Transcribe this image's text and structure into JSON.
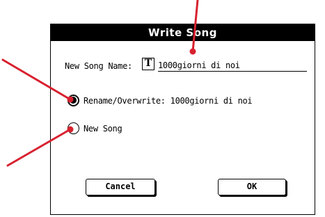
{
  "dialog": {
    "title": "Write Song",
    "name_label": "New Song Name:",
    "type_icon": "T",
    "type_icon_name": "text-edit-icon",
    "name_value": "1000giorni di noi",
    "options": [
      {
        "label": "Rename/Overwrite: 1000giorni di noi",
        "checked": true
      },
      {
        "label": "New Song",
        "checked": false
      }
    ],
    "cancel_label": "Cancel",
    "ok_label": "OK"
  },
  "colors": {
    "title_bg": "#000000",
    "title_fg": "#ffffff",
    "callout_line": "#d8212f"
  }
}
